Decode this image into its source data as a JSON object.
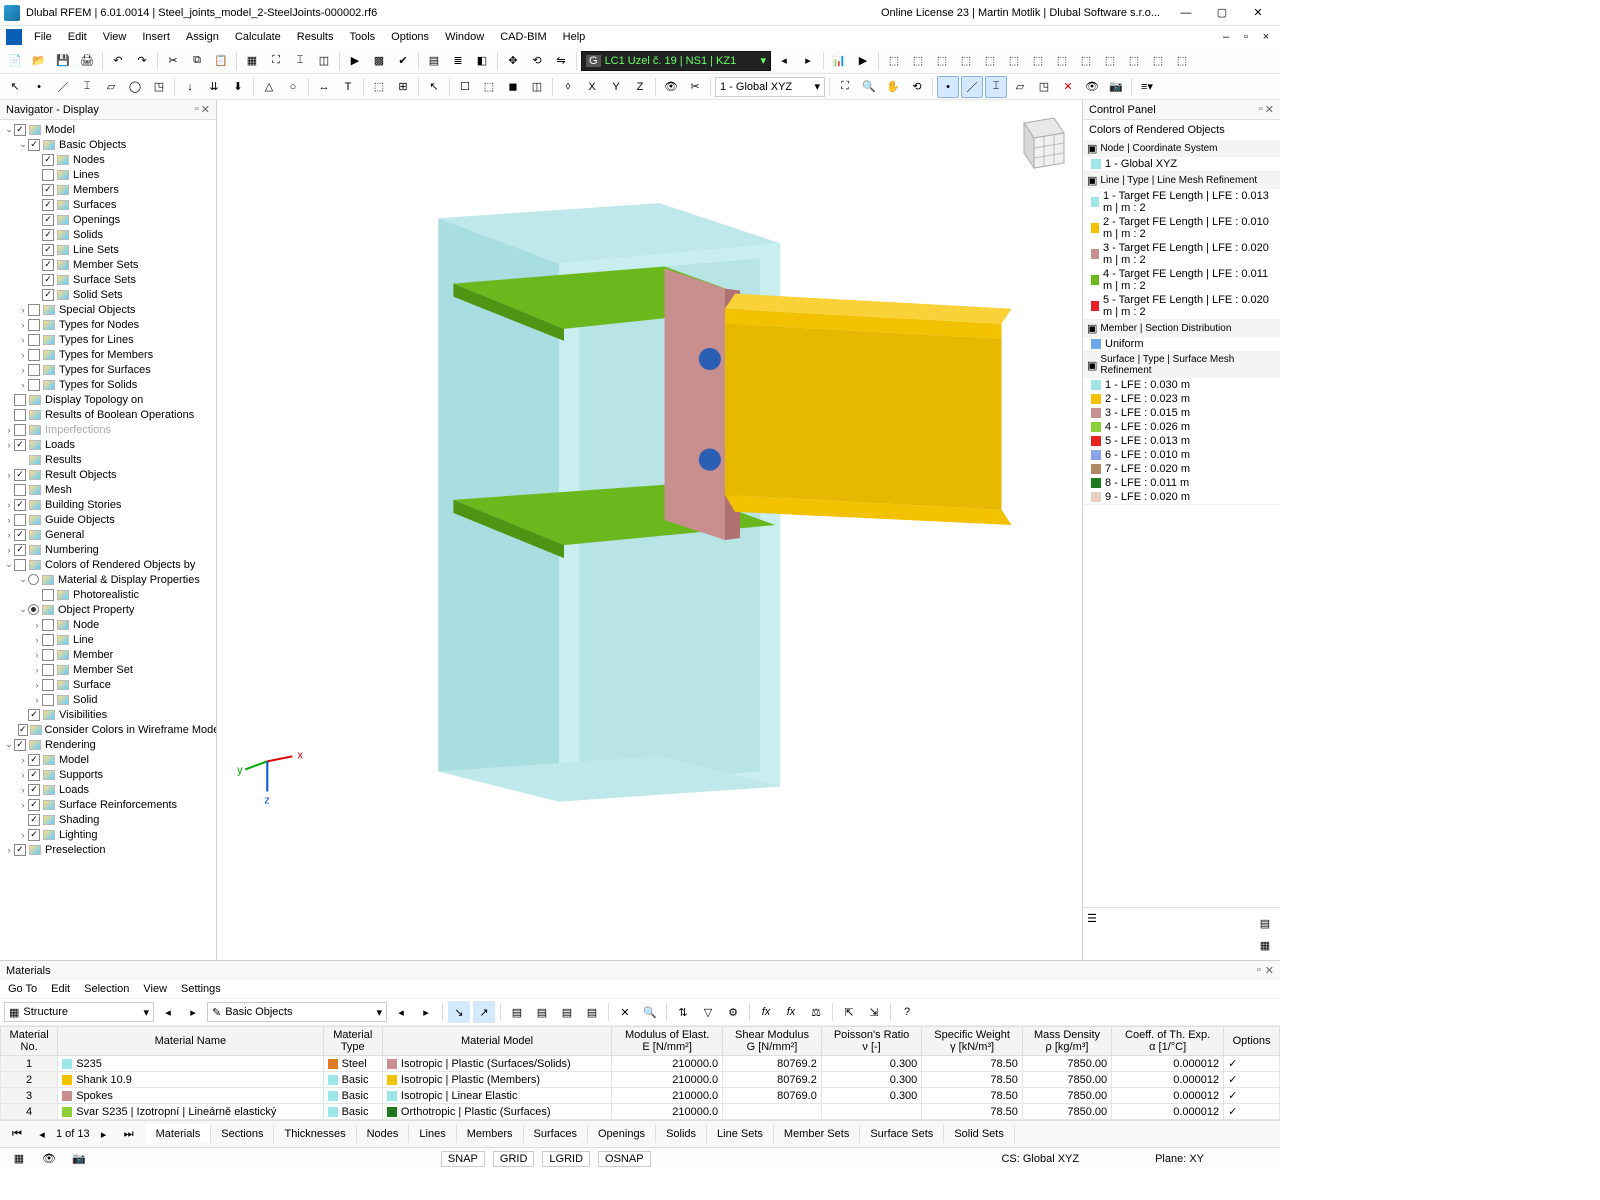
{
  "titlebar": {
    "title": "Dlubal RFEM | 6.01.0014 | Steel_joints_model_2-SteelJoints-000002.rf6",
    "license": "Online License 23 | Martin Motlik | Dlubal Software s.r.o..."
  },
  "menu": {
    "items": [
      "File",
      "Edit",
      "View",
      "Insert",
      "Assign",
      "Calculate",
      "Results",
      "Tools",
      "Options",
      "Window",
      "CAD-BIM",
      "Help"
    ]
  },
  "toolbar1": {
    "lc_combo": "LC1   Uzel č. 19 | NS1 | KZ1",
    "global_combo": "1 - Global XYZ"
  },
  "navigator": {
    "title": "Navigator - Display",
    "tree": [
      {
        "d": 0,
        "t": "v",
        "c": true,
        "i": "model",
        "l": "Model"
      },
      {
        "d": 1,
        "t": "v",
        "c": true,
        "i": "basic",
        "l": "Basic Objects"
      },
      {
        "d": 2,
        "t": "",
        "c": true,
        "i": "node",
        "l": "Nodes"
      },
      {
        "d": 2,
        "t": "",
        "c": false,
        "i": "line",
        "l": "Lines"
      },
      {
        "d": 2,
        "t": "",
        "c": true,
        "i": "member",
        "l": "Members"
      },
      {
        "d": 2,
        "t": "",
        "c": true,
        "i": "surface",
        "l": "Surfaces"
      },
      {
        "d": 2,
        "t": "",
        "c": true,
        "i": "opening",
        "l": "Openings"
      },
      {
        "d": 2,
        "t": "",
        "c": true,
        "i": "solid",
        "l": "Solids"
      },
      {
        "d": 2,
        "t": "",
        "c": true,
        "i": "lineset",
        "l": "Line Sets"
      },
      {
        "d": 2,
        "t": "",
        "c": true,
        "i": "memberset",
        "l": "Member Sets"
      },
      {
        "d": 2,
        "t": "",
        "c": true,
        "i": "surfset",
        "l": "Surface Sets"
      },
      {
        "d": 2,
        "t": "",
        "c": true,
        "i": "solidset",
        "l": "Solid Sets"
      },
      {
        "d": 1,
        "t": ">",
        "c": false,
        "i": "special",
        "l": "Special Objects"
      },
      {
        "d": 1,
        "t": ">",
        "c": false,
        "i": "tnode",
        "l": "Types for Nodes"
      },
      {
        "d": 1,
        "t": ">",
        "c": false,
        "i": "tline",
        "l": "Types for Lines"
      },
      {
        "d": 1,
        "t": ">",
        "c": false,
        "i": "tmem",
        "l": "Types for Members"
      },
      {
        "d": 1,
        "t": ">",
        "c": false,
        "i": "tsurf",
        "l": "Types for Surfaces"
      },
      {
        "d": 1,
        "t": ">",
        "c": false,
        "i": "tsol",
        "l": "Types for Solids"
      },
      {
        "d": 0,
        "t": "",
        "c": false,
        "i": "topo",
        "l": "Display Topology on"
      },
      {
        "d": 0,
        "t": "",
        "c": false,
        "i": "bool",
        "l": "Results of Boolean Operations"
      },
      {
        "d": 0,
        "t": ">",
        "c": null,
        "i": "imperf",
        "l": "Imperfections",
        "dim": true
      },
      {
        "d": 0,
        "t": ">",
        "c": true,
        "i": "loads",
        "l": "Loads"
      },
      {
        "d": 0,
        "t": "",
        "c": null,
        "i": "results",
        "l": "Results",
        "nobox": true
      },
      {
        "d": 0,
        "t": ">",
        "c": true,
        "i": "resobj",
        "l": "Result Objects"
      },
      {
        "d": 0,
        "t": "",
        "c": false,
        "i": "mesh",
        "l": "Mesh"
      },
      {
        "d": 0,
        "t": ">",
        "c": true,
        "i": "bstory",
        "l": "Building Stories"
      },
      {
        "d": 0,
        "t": ">",
        "c": false,
        "i": "guide",
        "l": "Guide Objects"
      },
      {
        "d": 0,
        "t": ">",
        "c": true,
        "i": "general",
        "l": "General"
      },
      {
        "d": 0,
        "t": ">",
        "c": true,
        "i": "num",
        "l": "Numbering"
      },
      {
        "d": 0,
        "t": "v",
        "c": false,
        "i": "colors",
        "l": "Colors of Rendered Objects by"
      },
      {
        "d": 1,
        "t": "v",
        "r": false,
        "i": "matdisp",
        "l": "Material & Display Properties"
      },
      {
        "d": 2,
        "t": "",
        "c": false,
        "i": "photo",
        "l": "Photorealistic"
      },
      {
        "d": 1,
        "t": "v",
        "r": true,
        "i": "objprop",
        "l": "Object Property"
      },
      {
        "d": 2,
        "t": ">",
        "c": false,
        "i": "node2",
        "l": "Node"
      },
      {
        "d": 2,
        "t": ">",
        "c": false,
        "i": "line2",
        "l": "Line"
      },
      {
        "d": 2,
        "t": ">",
        "c": false,
        "i": "mem2",
        "l": "Member"
      },
      {
        "d": 2,
        "t": ">",
        "c": false,
        "i": "mems2",
        "l": "Member Set"
      },
      {
        "d": 2,
        "t": ">",
        "c": false,
        "i": "surf2",
        "l": "Surface"
      },
      {
        "d": 2,
        "t": ">",
        "c": false,
        "i": "sol2",
        "l": "Solid"
      },
      {
        "d": 1,
        "t": "",
        "c": true,
        "i": "vis",
        "l": "Visibilities"
      },
      {
        "d": 1,
        "t": "",
        "c": true,
        "i": "wire",
        "l": "Consider Colors in Wireframe Model"
      },
      {
        "d": 0,
        "t": "v",
        "c": true,
        "i": "render",
        "l": "Rendering"
      },
      {
        "d": 1,
        "t": ">",
        "c": true,
        "i": "rmodel",
        "l": "Model"
      },
      {
        "d": 1,
        "t": ">",
        "c": true,
        "i": "rsup",
        "l": "Supports"
      },
      {
        "d": 1,
        "t": ">",
        "c": true,
        "i": "rloads",
        "l": "Loads"
      },
      {
        "d": 1,
        "t": ">",
        "c": true,
        "i": "rsurf",
        "l": "Surface Reinforcements"
      },
      {
        "d": 1,
        "t": "",
        "c": true,
        "i": "shading",
        "l": "Shading"
      },
      {
        "d": 1,
        "t": ">",
        "c": true,
        "i": "light",
        "l": "Lighting"
      },
      {
        "d": 0,
        "t": ">",
        "c": true,
        "i": "presel",
        "l": "Preselection"
      }
    ]
  },
  "controlpanel": {
    "title": "Control Panel",
    "subtitle": "Colors of Rendered Objects",
    "sections": [
      {
        "title": "Node | Coordinate System",
        "items": [
          {
            "c": "#9fe7e7",
            "l": "1 - Global XYZ"
          }
        ]
      },
      {
        "title": "Line | Type | Line Mesh Refinement",
        "items": [
          {
            "c": "#9fe7e7",
            "l": "1 - Target FE Length | LFE : 0.013 m | m : 2"
          },
          {
            "c": "#f2c200",
            "l": "2 - Target FE Length | LFE : 0.010 m | m : 2"
          },
          {
            "c": "#c98e8e",
            "l": "3 - Target FE Length | LFE : 0.020 m | m : 2"
          },
          {
            "c": "#6bb81e",
            "l": "4 - Target FE Length | LFE : 0.011 m | m : 2"
          },
          {
            "c": "#e52121",
            "l": "5 - Target FE Length | LFE : 0.020 m | m : 2"
          }
        ]
      },
      {
        "title": "Member | Section Distribution",
        "items": [
          {
            "c": "#6aa8e8",
            "l": "Uniform"
          }
        ]
      },
      {
        "title": "Surface | Type | Surface Mesh Refinement",
        "items": [
          {
            "c": "#9fe7e7",
            "l": "1 - LFE : 0.030 m"
          },
          {
            "c": "#f2c200",
            "l": "2 - LFE : 0.023 m"
          },
          {
            "c": "#c98e8e",
            "l": "3 - LFE : 0.015 m"
          },
          {
            "c": "#8cd13b",
            "l": "4 - LFE : 0.026 m"
          },
          {
            "c": "#e52121",
            "l": "5 - LFE : 0.013 m"
          },
          {
            "c": "#8aa4e8",
            "l": "6 - LFE : 0.010 m"
          },
          {
            "c": "#b08a66",
            "l": "7 - LFE : 0.020 m"
          },
          {
            "c": "#1f7a1f",
            "l": "8 - LFE : 0.011 m"
          },
          {
            "c": "#e8cfc0",
            "l": "9 - LFE : 0.020 m"
          }
        ]
      }
    ]
  },
  "materials": {
    "title": "Materials",
    "menu": [
      "Go To",
      "Edit",
      "Selection",
      "View",
      "Settings"
    ],
    "struct_combo": "Structure",
    "basic_combo": "Basic Objects",
    "pager": "1 of 13",
    "headers": [
      "Material\nNo.",
      "Material Name",
      "Material\nType",
      "Material Model",
      "Modulus of Elast.\nE [N/mm²]",
      "Shear Modulus\nG [N/mm²]",
      "Poisson's Ratio\nν [-]",
      "Specific Weight\nγ [kN/m³]",
      "Mass Density\nρ [kg/m³]",
      "Coeff. of Th. Exp.\nα [1/°C]",
      "Options"
    ],
    "rows": [
      {
        "no": "1",
        "sw": "#9fe7e7",
        "name": "S235",
        "tsw": "#e07a24",
        "type": "Steel",
        "msw": "#c98e8e",
        "model": "Isotropic | Plastic (Surfaces/Solids)",
        "E": "210000.0",
        "G": "80769.2",
        "nu": "0.300",
        "gamma": "78.50",
        "rho": "7850.00",
        "alpha": "0.000012",
        "opt": "✓"
      },
      {
        "no": "2",
        "sw": "#f2c200",
        "name": "Shank 10.9",
        "tsw": "#9fe7e7",
        "type": "Basic",
        "msw": "#f2c200",
        "model": "Isotropic | Plastic (Members)",
        "E": "210000.0",
        "G": "80769.2",
        "nu": "0.300",
        "gamma": "78.50",
        "rho": "7850.00",
        "alpha": "0.000012",
        "opt": "✓"
      },
      {
        "no": "3",
        "sw": "#c98e8e",
        "name": "Spokes",
        "tsw": "#9fe7e7",
        "type": "Basic",
        "msw": "#9fe7e7",
        "model": "Isotropic | Linear Elastic",
        "E": "210000.0",
        "G": "80769.0",
        "nu": "0.300",
        "gamma": "78.50",
        "rho": "7850.00",
        "alpha": "0.000012",
        "opt": "✓"
      },
      {
        "no": "4",
        "sw": "#8cd13b",
        "name": "Svar S235 | Izotropní | Lineárně elastický",
        "tsw": "#9fe7e7",
        "type": "Basic",
        "msw": "#1f7a1f",
        "model": "Orthotropic | Plastic (Surfaces)",
        "E": "210000.0",
        "G": "",
        "nu": "",
        "gamma": "78.50",
        "rho": "7850.00",
        "alpha": "0.000012",
        "opt": "✓"
      }
    ],
    "tabs": [
      "Materials",
      "Sections",
      "Thicknesses",
      "Nodes",
      "Lines",
      "Members",
      "Surfaces",
      "Openings",
      "Solids",
      "Line Sets",
      "Member Sets",
      "Surface Sets",
      "Solid Sets"
    ]
  },
  "statusbar": {
    "snap": "SNAP",
    "grid": "GRID",
    "lgrid": "LGRID",
    "osnap": "OSNAP",
    "cs": "CS: Global XYZ",
    "plane": "Plane: XY"
  }
}
